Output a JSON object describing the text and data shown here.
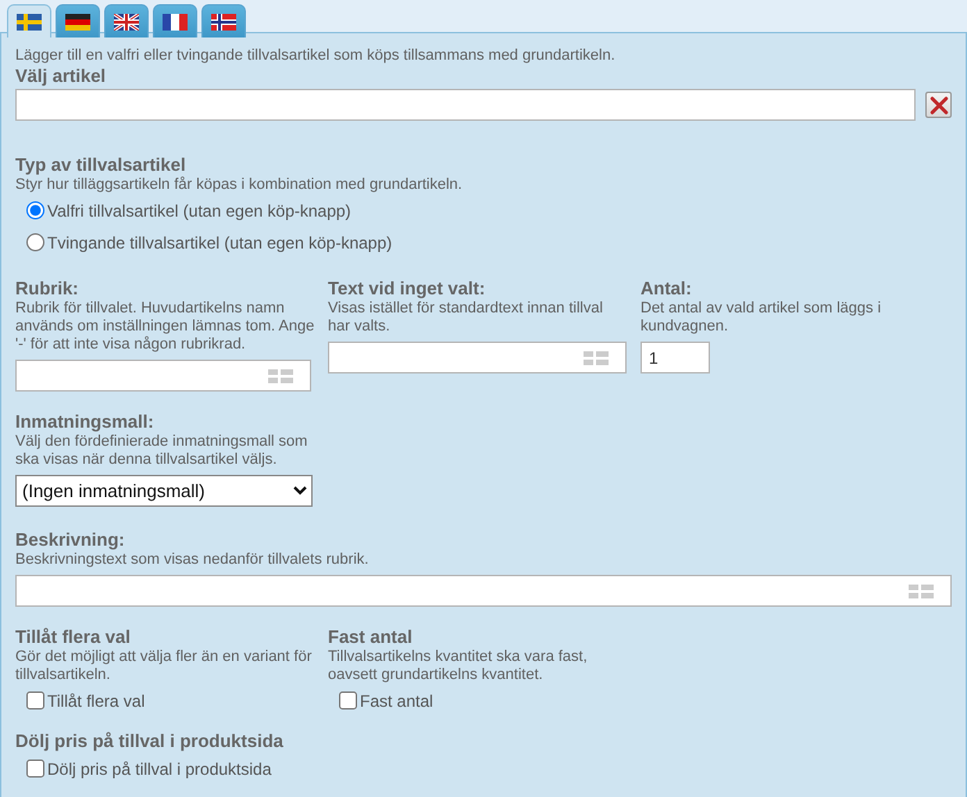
{
  "tabs": [
    {
      "kind": "se",
      "selected": true
    },
    {
      "kind": "de",
      "selected": false
    },
    {
      "kind": "gb",
      "selected": false
    },
    {
      "kind": "fr",
      "selected": false
    },
    {
      "kind": "no",
      "selected": false
    }
  ],
  "intro": "Lägger till en valfri eller tvingande tillvalsartikel som köps tillsammans med grundartikeln.",
  "article": {
    "label": "Välj artikel"
  },
  "type_section": {
    "title": "Typ av tillvalsartikel",
    "hint": "Styr hur tilläggsartikeln får köpas i kombination med grundartikeln.",
    "options": [
      {
        "label": "Valfri tillvalsartikel (utan egen köp-knapp)",
        "selected": true
      },
      {
        "label": "Tvingande tillvalsartikel (utan egen köp-knapp)",
        "selected": false
      }
    ]
  },
  "fields": [
    {
      "label": "Rubrik:",
      "hint": "Rubrik för tillvalet. Huvudartikelns namn används om inställningen lämnas tom. Ange '-' för att inte visa någon rubrikrad.",
      "kind": "translatable"
    },
    {
      "label": "Text vid inget valt:",
      "hint": "Visas istället för standardtext innan tillval har valts.",
      "kind": "translatable"
    },
    {
      "label": "Antal:",
      "hint": "Det antal av vald artikel som läggs i kundvagnen.",
      "kind": "number",
      "value": "1"
    }
  ],
  "template": {
    "label": "Inmatningsmall:",
    "hint": "Välj den fördefinierade inmatningsmall som ska visas när denna tillvalsartikel väljs.",
    "value": "(Ingen inmatningsmall)"
  },
  "description": {
    "label": "Beskrivning:",
    "hint": "Beskrivningstext som visas nedanför tillvalets rubrik."
  },
  "options_row": [
    {
      "title": "Tillåt flera val",
      "hint": "Gör det möjligt att välja fler än en variant för tillvalsartikeln.",
      "checkbox": "Tillåt flera val",
      "checked": false
    },
    {
      "title": "Fast antal",
      "hint": "Tillvalsartikelns kvantitet ska vara fast, oavsett grundartikelns kvantitet.",
      "checkbox": "Fast antal",
      "checked": false
    }
  ],
  "hide_price": {
    "title": "Dölj pris på tillval i produktsida",
    "checkbox": "Dölj pris på tillval i produktsida",
    "checked": false
  }
}
